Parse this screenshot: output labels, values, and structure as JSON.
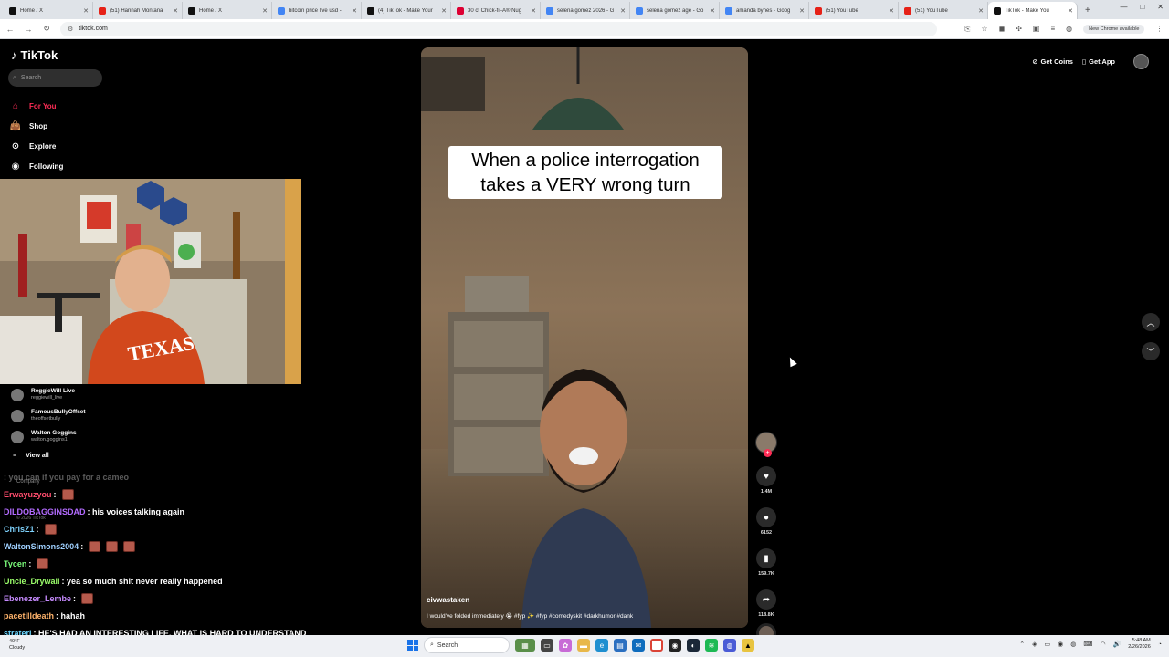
{
  "browser": {
    "tabs": [
      {
        "title": "Home / X",
        "color": "#111111",
        "active": false
      },
      {
        "title": "(51) Hannah Montana",
        "color": "#e62117",
        "active": false
      },
      {
        "title": "Home / X",
        "color": "#111111",
        "active": false
      },
      {
        "title": "bitcoin price live usd -",
        "color": "#4285f4",
        "active": false
      },
      {
        "title": "(4) TikTok - Make Your",
        "color": "#111111",
        "active": false
      },
      {
        "title": "30 ct Chick-fil-A® Nug",
        "color": "#dd0033",
        "active": false
      },
      {
        "title": "selena gomez 2026 - G",
        "color": "#4285f4",
        "active": false
      },
      {
        "title": "selena gomez age - Go",
        "color": "#4285f4",
        "active": false
      },
      {
        "title": "amanda bynes - Goog",
        "color": "#4285f4",
        "active": false
      },
      {
        "title": "(51) YouTube",
        "color": "#e62117",
        "active": false
      },
      {
        "title": "(51) YouTube",
        "color": "#e62117",
        "active": false
      },
      {
        "title": "TikTok - Make You",
        "color": "#111111",
        "active": true
      }
    ],
    "new_tab": "+",
    "url": "tiktok.com",
    "update_label": "New Chrome available"
  },
  "tiktok": {
    "logo": "TikTok",
    "search_placeholder": "Search",
    "nav": [
      {
        "label": "For You",
        "icon": "home-icon",
        "glyph": "⌂",
        "active": true
      },
      {
        "label": "Shop",
        "icon": "shop-bag-icon",
        "glyph": "👜",
        "active": false
      },
      {
        "label": "Explore",
        "icon": "compass-icon",
        "glyph": "⊙",
        "active": false
      },
      {
        "label": "Following",
        "icon": "following-icon",
        "glyph": "◉",
        "active": false
      }
    ],
    "following_accounts": [
      {
        "name": "ReggieWill Live",
        "handle": "reggiewill_live"
      },
      {
        "name": "FamousBullyOffset",
        "handle": "theoffsetbully"
      },
      {
        "name": "Walton Goggins",
        "handle": "walton.goggins1"
      }
    ],
    "view_all": "View all",
    "footer_company": "Company",
    "footer_copyright": "© 2026 TikTok",
    "header": {
      "get_coins": "Get Coins",
      "get_app": "Get App"
    },
    "video": {
      "caption_line1": "When a police interrogation",
      "caption_line2": "takes a VERY wrong turn",
      "username": "civwastaken",
      "description": "I would've folded immediately 😭 #fyp ✨ #fyp #comedyskit #darkhumor #dank"
    },
    "actions": {
      "likes": "1.4M",
      "comments": "6152",
      "saves": "159.7K",
      "shares": "118.8K"
    }
  },
  "chat": [
    {
      "user": "",
      "message": ": you can if you pay for a cameo",
      "color": "#ffffff",
      "faded": true,
      "emotes": 0
    },
    {
      "user": "Erwayuzyou",
      "message": " :",
      "color": "#ff4d6d",
      "faded": false,
      "emotes": 1
    },
    {
      "user": "DILDOBAGGINSDAD",
      "message": " : his voices talking again",
      "color": "#b36bff",
      "faded": false,
      "emotes": 0
    },
    {
      "user": "ChrisZ1",
      "message": " :",
      "color": "#7fd4ff",
      "faded": false,
      "emotes": 1
    },
    {
      "user": "WaltonSimons2004",
      "message": " :",
      "color": "#9fd0ff",
      "faded": false,
      "emotes": 3
    },
    {
      "user": "Tycen",
      "message": " :",
      "color": "#7cff7c",
      "faded": false,
      "emotes": 1
    },
    {
      "user": "Uncle_Drywall",
      "message": " : yea so much shit never really happened",
      "color": "#9cff6b",
      "faded": false,
      "emotes": 0
    },
    {
      "user": "Ebenezer_Lembe",
      "message": " :",
      "color": "#c78bff",
      "faded": false,
      "emotes": 1
    },
    {
      "user": "pacetilldeath",
      "message": " : hahah",
      "color": "#ffb36b",
      "faded": false,
      "emotes": 0
    },
    {
      "user": "strateri",
      "message": " : HE'S HAD AN INTERESTING LIFE, WHAT IS HARD TO UNDERSTAND",
      "color": "#6bd6ff",
      "faded": false,
      "emotes": 0
    }
  ],
  "taskbar": {
    "weather_temp": "40°F",
    "weather_desc": "Cloudy",
    "search_label": "Search",
    "time": "5:48 AM",
    "date": "2/26/2026"
  }
}
